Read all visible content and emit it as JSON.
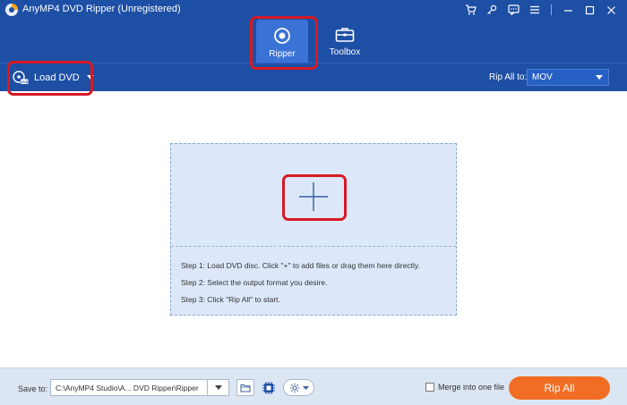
{
  "window": {
    "title": "AnyMP4 DVD Ripper (Unregistered)",
    "icons": [
      "cart-icon",
      "key-icon",
      "feedback-icon",
      "menu-icon",
      "minimize-icon",
      "maximize-icon",
      "close-icon"
    ]
  },
  "modes": {
    "ripper_label": "Ripper",
    "toolbox_label": "Toolbox"
  },
  "toolbar": {
    "load_dvd_label": "Load DVD",
    "rip_all_to_label": "Rip All to:",
    "format_value": "MOV"
  },
  "dropzone": {
    "steps": [
      "Step 1: Load DVD disc. Click \"+\" to add files or drag them here directly.",
      "Step 2: Select the output format you desire.",
      "Step 3: Click \"Rip All\" to start."
    ]
  },
  "bottom": {
    "save_to_label": "Save to:",
    "save_path": "C:\\AnyMP4 Studio\\A... DVD Ripper\\Ripper",
    "merge_label": "Merge into one file",
    "rip_all_label": "Rip All"
  },
  "colors": {
    "header_blue": "#1d4fa5",
    "active_tab": "#3a72d6",
    "highlight_red": "#d61a23",
    "rip_orange": "#f26d24",
    "dropzone_bg": "#dce8f9"
  }
}
